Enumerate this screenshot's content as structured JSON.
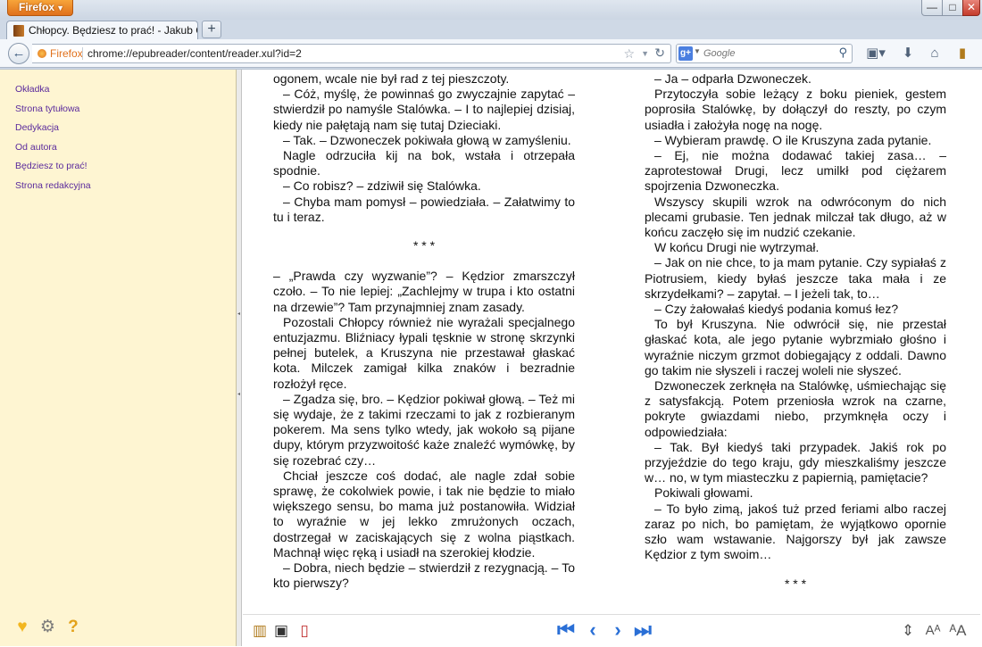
{
  "browser": {
    "menu_button": "Firefox",
    "window_controls": {
      "minimize": "—",
      "maximize": "□",
      "close": "✕"
    },
    "tab_title": "Chłopcy. Będziesz to prać! - Jakub Ćwiek",
    "new_tab": "+",
    "identity_label": "Firefox",
    "url": "chrome://epubreader/content/reader.xul?id=2",
    "search_engine": "g+",
    "search_placeholder": "Google"
  },
  "sidebar": {
    "toc": [
      "Okładka",
      "Strona tytułowa",
      "Dedykacja",
      "Od autora",
      "Będziesz to prać!",
      "Strona redakcyjna"
    ]
  },
  "book": {
    "left_column": [
      {
        "t": "ogonem, wcale nie był rad z tej pieszczoty.",
        "noind": true
      },
      {
        "t": "– Cóż, myślę, że powinnaś go zwyczajnie zapytać – stwierdził po namyśle Stalówka. – I to najlepiej dzisiaj, kiedy nie pałętają nam się tutaj Dzieciaki."
      },
      {
        "t": "– Tak. – Dzwoneczek pokiwała głową w zamyśleniu."
      },
      {
        "t": "Nagle odrzuciła kij na bok, wstała i otrzepała spodnie."
      },
      {
        "t": "– Co robisz? – zdziwił się Stalówka."
      },
      {
        "t": "– Chyba mam pomysł – powiedziała. – Załatwimy to tu i teraz."
      },
      {
        "sep": "* * *"
      },
      {
        "t": "– „Prawda czy wyzwanie”? – Kędzior zmarszczył czoło. – To nie lepiej: „Zachlejmy w trupa i kto ostatni na drzewie”? Tam przynajmniej znam zasady.",
        "noind": true
      },
      {
        "t": "Pozostali Chłopcy również nie wyrażali specjalnego entuzjazmu. Bliźniacy łypali tęsknie w stronę skrzynki pełnej butelek, a Kruszyna nie przestawał głaskać kota. Milczek zamigał kilka znaków i bezradnie rozłożył ręce."
      },
      {
        "t": "– Zgadza się, bro. – Kędzior pokiwał głową. – Też mi się wydaje, że z takimi rzeczami to jak z rozbieranym pokerem. Ma sens tylko wtedy, jak wokoło są pijane dupy, którym przyzwoitość każe znaleźć wymówkę, by się rozebrać czy…"
      },
      {
        "t": "Chciał jeszcze coś dodać, ale nagle zdał sobie sprawę, że cokolwiek powie, i tak nie będzie to miało większego sensu, bo mama już postanowiła. Widział to wyraźnie w jej lekko zmrużonych oczach, dostrzegał w zaciskających się z wolna piąstkach. Machnął więc ręką i usiadł na szerokiej kłodzie."
      },
      {
        "t": "– Dobra, niech będzie – stwierdził z rezygnacją. – To kto pierwszy?"
      }
    ],
    "right_column": [
      {
        "t": "– Ja – odparła Dzwoneczek."
      },
      {
        "t": "Przytoczyła sobie leżący z boku pieniek, gestem poprosiła Stalówkę, by dołączył do reszty, po czym usiadła i założyła nogę na nogę."
      },
      {
        "t": "– Wybieram prawdę. O ile Kruszyna zada pytanie."
      },
      {
        "t": "– Ej, nie można dodawać takiej zasa… – zaprotestował Drugi, lecz umilkł pod ciężarem spojrzenia Dzwoneczka."
      },
      {
        "t": "Wszyscy skupili wzrok na odwróconym do nich plecami grubasie. Ten jednak milczał tak długo, aż w końcu zaczęło się im nudzić czekanie."
      },
      {
        "t": "W końcu Drugi nie wytrzymał."
      },
      {
        "t": "– Jak on nie chce, to ja mam pytanie. Czy sypiałaś z Piotrusiem, kiedy byłaś jeszcze taka mała i ze skrzydełkami? – zapytał. – I jeżeli tak, to…"
      },
      {
        "t": "– Czy żałowałaś kiedyś podania komuś łez?"
      },
      {
        "t": "To był Kruszyna. Nie odwrócił się, nie przestał głaskać kota, ale jego pytanie wybrzmiało głośno i wyraźnie niczym grzmot dobiegający z oddali. Dawno go takim nie słyszeli i raczej woleli nie słyszeć."
      },
      {
        "t": "Dzwoneczek zerknęła na Stalówkę, uśmiechając się z satysfakcją. Potem przeniosła wzrok na czarne, pokryte gwiazdami niebo, przymknęła oczy i odpowiedziała:"
      },
      {
        "t": "– Tak. Był kiedyś taki przypadek. Jakiś rok po przyjeździe do tego kraju, gdy mieszkaliśmy jeszcze w… no, w tym miasteczku z papiernią, pamiętacie?"
      },
      {
        "t": "Pokiwali głowami."
      },
      {
        "t": "– To było zimą, jakoś tuż przed feriami albo raczej zaraz po nich, bo pamiętam, że wyjątkowo opornie szło wam wstawanie. Najgorszy był jak zawsze Kędzior z tym swoim…"
      },
      {
        "sep": "* * *"
      }
    ]
  },
  "reader_toolbar": {
    "first": "⏮",
    "prev": "‹",
    "next": "›",
    "last": "⏭"
  },
  "colors": {
    "sidebar_bg": "#fef5d2",
    "toc_link": "#5a2a9c",
    "nav_arrows": "#2a6fd6",
    "firefox_button": "#e0701b"
  }
}
